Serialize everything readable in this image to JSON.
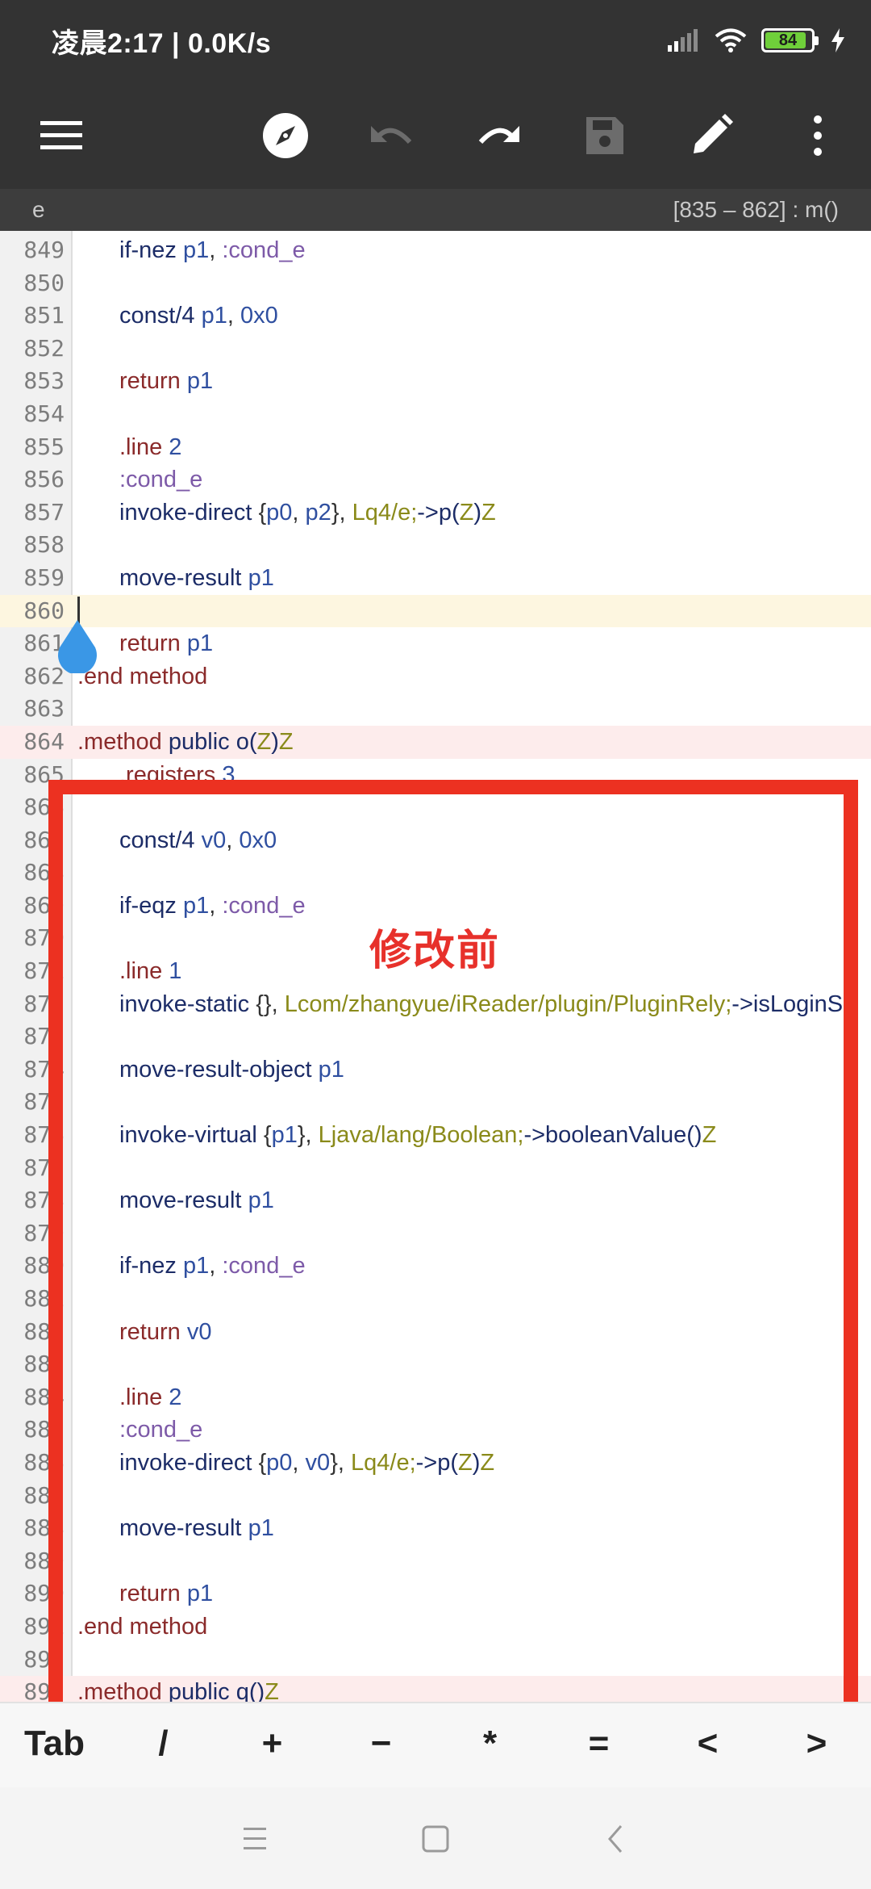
{
  "status_bar": {
    "time_speed": "凌晨2:17 | 0.0K/s",
    "battery": "84"
  },
  "toolbar": {
    "icons": [
      "menu-icon",
      "compass-icon",
      "undo-icon",
      "redo-icon",
      "save-icon",
      "edit-icon",
      "more-icon"
    ]
  },
  "info_bar": {
    "file": "e",
    "position": "[835 – 862] : m()"
  },
  "editor": {
    "lines": [
      {
        "n": "849",
        "t": [
          [
            "kw",
            "if-nez"
          ],
          [
            "pun",
            " "
          ],
          [
            "reg",
            "p1"
          ],
          [
            "pun",
            ", "
          ],
          [
            "lbl",
            ":cond_e"
          ]
        ],
        "indent": true
      },
      {
        "n": "850",
        "t": []
      },
      {
        "n": "851",
        "t": [
          [
            "kw",
            "const/4"
          ],
          [
            "pun",
            " "
          ],
          [
            "reg",
            "p1"
          ],
          [
            "pun",
            ", "
          ],
          [
            "num",
            "0x0"
          ]
        ],
        "indent": true
      },
      {
        "n": "852",
        "t": []
      },
      {
        "n": "853",
        "t": [
          [
            "dir",
            "return"
          ],
          [
            "pun",
            " "
          ],
          [
            "reg",
            "p1"
          ]
        ],
        "indent": true
      },
      {
        "n": "854",
        "t": []
      },
      {
        "n": "855",
        "t": [
          [
            "dir",
            ".line"
          ],
          [
            "pun",
            " "
          ],
          [
            "num",
            "2"
          ]
        ],
        "indent": true
      },
      {
        "n": "856",
        "t": [
          [
            "lbl",
            ":cond_e"
          ]
        ],
        "indent": true
      },
      {
        "n": "857",
        "t": [
          [
            "kw",
            "invoke-direct"
          ],
          [
            "pun",
            " {"
          ],
          [
            "reg",
            "p0"
          ],
          [
            "pun",
            ", "
          ],
          [
            "reg",
            "p2"
          ],
          [
            "pun",
            "}, "
          ],
          [
            "typ",
            "Lq4/e;"
          ],
          [
            "kw",
            "->p("
          ],
          [
            "typ",
            "Z"
          ],
          [
            "kw",
            ")"
          ],
          [
            "typ",
            "Z"
          ]
        ],
        "indent": true
      },
      {
        "n": "858",
        "t": []
      },
      {
        "n": "859",
        "t": [
          [
            "kw",
            "move-result"
          ],
          [
            "pun",
            " "
          ],
          [
            "reg",
            "p1"
          ]
        ],
        "indent": true
      },
      {
        "n": "860",
        "t": [],
        "hl": "yellow",
        "cursor": true
      },
      {
        "n": "861",
        "t": [
          [
            "dir",
            "return"
          ],
          [
            "pun",
            " "
          ],
          [
            "reg",
            "p1"
          ]
        ],
        "indent": true
      },
      {
        "n": "862",
        "t": [
          [
            "dirkw",
            ".end"
          ],
          [
            "pun",
            " "
          ],
          [
            "dirkw",
            "method"
          ]
        ]
      },
      {
        "n": "863",
        "t": []
      },
      {
        "n": "864",
        "t": [
          [
            "dirkw",
            ".method"
          ],
          [
            "pun",
            " "
          ],
          [
            "kw",
            "public"
          ],
          [
            "pun",
            " "
          ],
          [
            "kw",
            "o("
          ],
          [
            "typ",
            "Z"
          ],
          [
            "kw",
            ")"
          ],
          [
            "typ",
            "Z"
          ]
        ],
        "hl": "pink"
      },
      {
        "n": "865",
        "t": [
          [
            "dir",
            ".registers"
          ],
          [
            "pun",
            " "
          ],
          [
            "num",
            "3"
          ]
        ],
        "indent": true
      },
      {
        "n": "866",
        "t": []
      },
      {
        "n": "867",
        "t": [
          [
            "kw",
            "const/4"
          ],
          [
            "pun",
            " "
          ],
          [
            "reg",
            "v0"
          ],
          [
            "pun",
            ", "
          ],
          [
            "num",
            "0x0"
          ]
        ],
        "indent": true
      },
      {
        "n": "868",
        "t": []
      },
      {
        "n": "869",
        "t": [
          [
            "kw",
            "if-eqz"
          ],
          [
            "pun",
            " "
          ],
          [
            "reg",
            "p1"
          ],
          [
            "pun",
            ", "
          ],
          [
            "lbl",
            ":cond_e"
          ]
        ],
        "indent": true
      },
      {
        "n": "870",
        "t": []
      },
      {
        "n": "871",
        "t": [
          [
            "dir",
            ".line"
          ],
          [
            "pun",
            " "
          ],
          [
            "num",
            "1"
          ]
        ],
        "indent": true
      },
      {
        "n": "872",
        "t": [
          [
            "kw",
            "invoke-static"
          ],
          [
            "pun",
            " {}, "
          ],
          [
            "typ",
            "Lcom/zhangyue/iReader/plugin/PluginRely;"
          ],
          [
            "kw",
            "->isLoginS"
          ]
        ],
        "indent": true
      },
      {
        "n": "873",
        "t": []
      },
      {
        "n": "874",
        "t": [
          [
            "kw",
            "move-result-object"
          ],
          [
            "pun",
            " "
          ],
          [
            "reg",
            "p1"
          ]
        ],
        "indent": true
      },
      {
        "n": "875",
        "t": []
      },
      {
        "n": "876",
        "t": [
          [
            "kw",
            "invoke-virtual"
          ],
          [
            "pun",
            " {"
          ],
          [
            "reg",
            "p1"
          ],
          [
            "pun",
            "}, "
          ],
          [
            "typ",
            "Ljava/lang/Boolean;"
          ],
          [
            "kw",
            "->booleanValue()"
          ],
          [
            "typ",
            "Z"
          ]
        ],
        "indent": true
      },
      {
        "n": "877",
        "t": []
      },
      {
        "n": "878",
        "t": [
          [
            "kw",
            "move-result"
          ],
          [
            "pun",
            " "
          ],
          [
            "reg",
            "p1"
          ]
        ],
        "indent": true
      },
      {
        "n": "879",
        "t": []
      },
      {
        "n": "880",
        "t": [
          [
            "kw",
            "if-nez"
          ],
          [
            "pun",
            " "
          ],
          [
            "reg",
            "p1"
          ],
          [
            "pun",
            ", "
          ],
          [
            "lbl",
            ":cond_e"
          ]
        ],
        "indent": true
      },
      {
        "n": "881",
        "t": []
      },
      {
        "n": "882",
        "t": [
          [
            "dir",
            "return"
          ],
          [
            "pun",
            " "
          ],
          [
            "reg",
            "v0"
          ]
        ],
        "indent": true
      },
      {
        "n": "883",
        "t": []
      },
      {
        "n": "884",
        "t": [
          [
            "dir",
            ".line"
          ],
          [
            "pun",
            " "
          ],
          [
            "num",
            "2"
          ]
        ],
        "indent": true
      },
      {
        "n": "885",
        "t": [
          [
            "lbl",
            ":cond_e"
          ]
        ],
        "indent": true
      },
      {
        "n": "886",
        "t": [
          [
            "kw",
            "invoke-direct"
          ],
          [
            "pun",
            " {"
          ],
          [
            "reg",
            "p0"
          ],
          [
            "pun",
            ", "
          ],
          [
            "reg",
            "v0"
          ],
          [
            "pun",
            "}, "
          ],
          [
            "typ",
            "Lq4/e;"
          ],
          [
            "kw",
            "->p("
          ],
          [
            "typ",
            "Z"
          ],
          [
            "kw",
            ")"
          ],
          [
            "typ",
            "Z"
          ]
        ],
        "indent": true
      },
      {
        "n": "887",
        "t": []
      },
      {
        "n": "888",
        "t": [
          [
            "kw",
            "move-result"
          ],
          [
            "pun",
            " "
          ],
          [
            "reg",
            "p1"
          ]
        ],
        "indent": true
      },
      {
        "n": "889",
        "t": []
      },
      {
        "n": "890",
        "t": [
          [
            "dir",
            "return"
          ],
          [
            "pun",
            " "
          ],
          [
            "reg",
            "p1"
          ]
        ],
        "indent": true
      },
      {
        "n": "891",
        "t": [
          [
            "dirkw",
            ".end"
          ],
          [
            "pun",
            " "
          ],
          [
            "dirkw",
            "method"
          ]
        ]
      },
      {
        "n": "892",
        "t": []
      },
      {
        "n": "893",
        "t": [
          [
            "dirkw",
            ".method"
          ],
          [
            "pun",
            " "
          ],
          [
            "kw",
            "public"
          ],
          [
            "pun",
            " "
          ],
          [
            "kw",
            "q()"
          ],
          [
            "typ",
            "Z"
          ]
        ],
        "hl": "pink"
      }
    ]
  },
  "annotation": {
    "label": "修改前",
    "color": "#ec3121"
  },
  "symbol_bar": {
    "keys": [
      "Tab",
      "/",
      "+",
      "−",
      "*",
      "=",
      "<",
      ">"
    ]
  },
  "nav_bar": {
    "icons": [
      "recent-apps-icon",
      "home-icon",
      "back-icon"
    ]
  }
}
